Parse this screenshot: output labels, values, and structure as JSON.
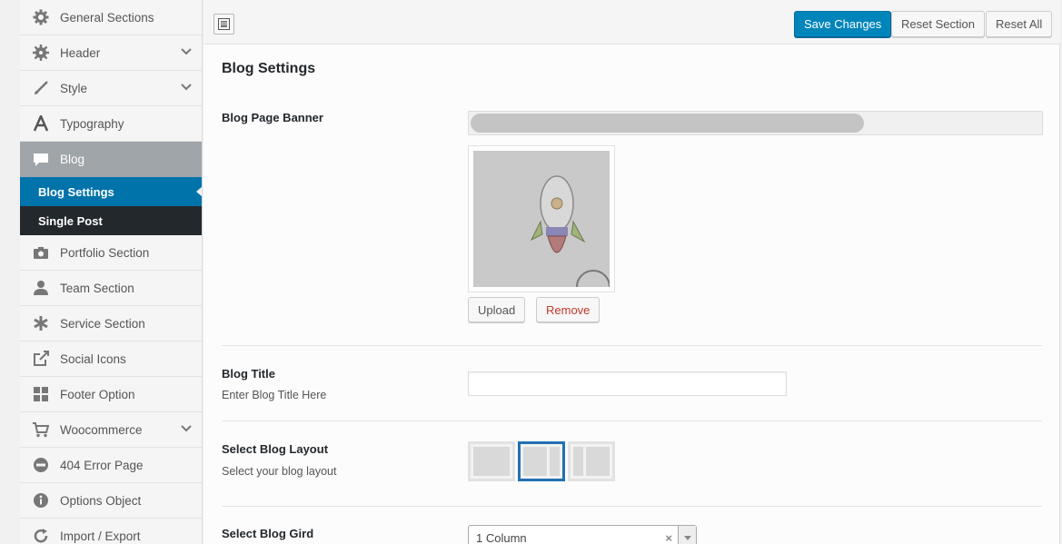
{
  "sidebar": {
    "items": [
      {
        "label": "General Sections",
        "icon": "gear-icon"
      },
      {
        "label": "Header",
        "icon": "cog-icon",
        "expandable": true
      },
      {
        "label": "Style",
        "icon": "brush-icon",
        "expandable": true
      },
      {
        "label": "Typography",
        "icon": "font-icon"
      },
      {
        "label": "Blog",
        "icon": "comment-icon",
        "active": true
      },
      {
        "label": "Portfolio Section",
        "icon": "camera-icon"
      },
      {
        "label": "Team Section",
        "icon": "user-icon"
      },
      {
        "label": "Service Section",
        "icon": "asterisk-icon"
      },
      {
        "label": "Social Icons",
        "icon": "share-icon"
      },
      {
        "label": "Footer Option",
        "icon": "grid-icon"
      },
      {
        "label": "Woocommerce",
        "icon": "cart-icon",
        "expandable": true
      },
      {
        "label": "404 Error Page",
        "icon": "minus-circle-icon"
      },
      {
        "label": "Options Object",
        "icon": "info-icon"
      },
      {
        "label": "Import / Export",
        "icon": "refresh-icon"
      }
    ],
    "blog_sub": [
      {
        "label": "Blog Settings",
        "current": true
      },
      {
        "label": "Single Post"
      }
    ]
  },
  "toolbar": {
    "save_label": "Save Changes",
    "reset_section_label": "Reset Section",
    "reset_all_label": "Reset All"
  },
  "section": {
    "title": "Blog Settings"
  },
  "fields": {
    "banner": {
      "label": "Blog Page Banner",
      "progress": 0.69,
      "upload_label": "Upload",
      "remove_label": "Remove"
    },
    "blog_title": {
      "label": "Blog Title",
      "desc": "Enter Blog Title Here",
      "value": ""
    },
    "layout": {
      "label": "Select Blog Layout",
      "desc": "Select your blog layout",
      "selected_index": 1
    },
    "grid": {
      "label": "Select Blog Gird",
      "value": "1 Column",
      "clear": "×"
    }
  },
  "colors": {
    "primary": "#0085ba",
    "active_sub": "#0073aa",
    "sidebar_dark": "#23282d",
    "remove": "#c0392b"
  }
}
